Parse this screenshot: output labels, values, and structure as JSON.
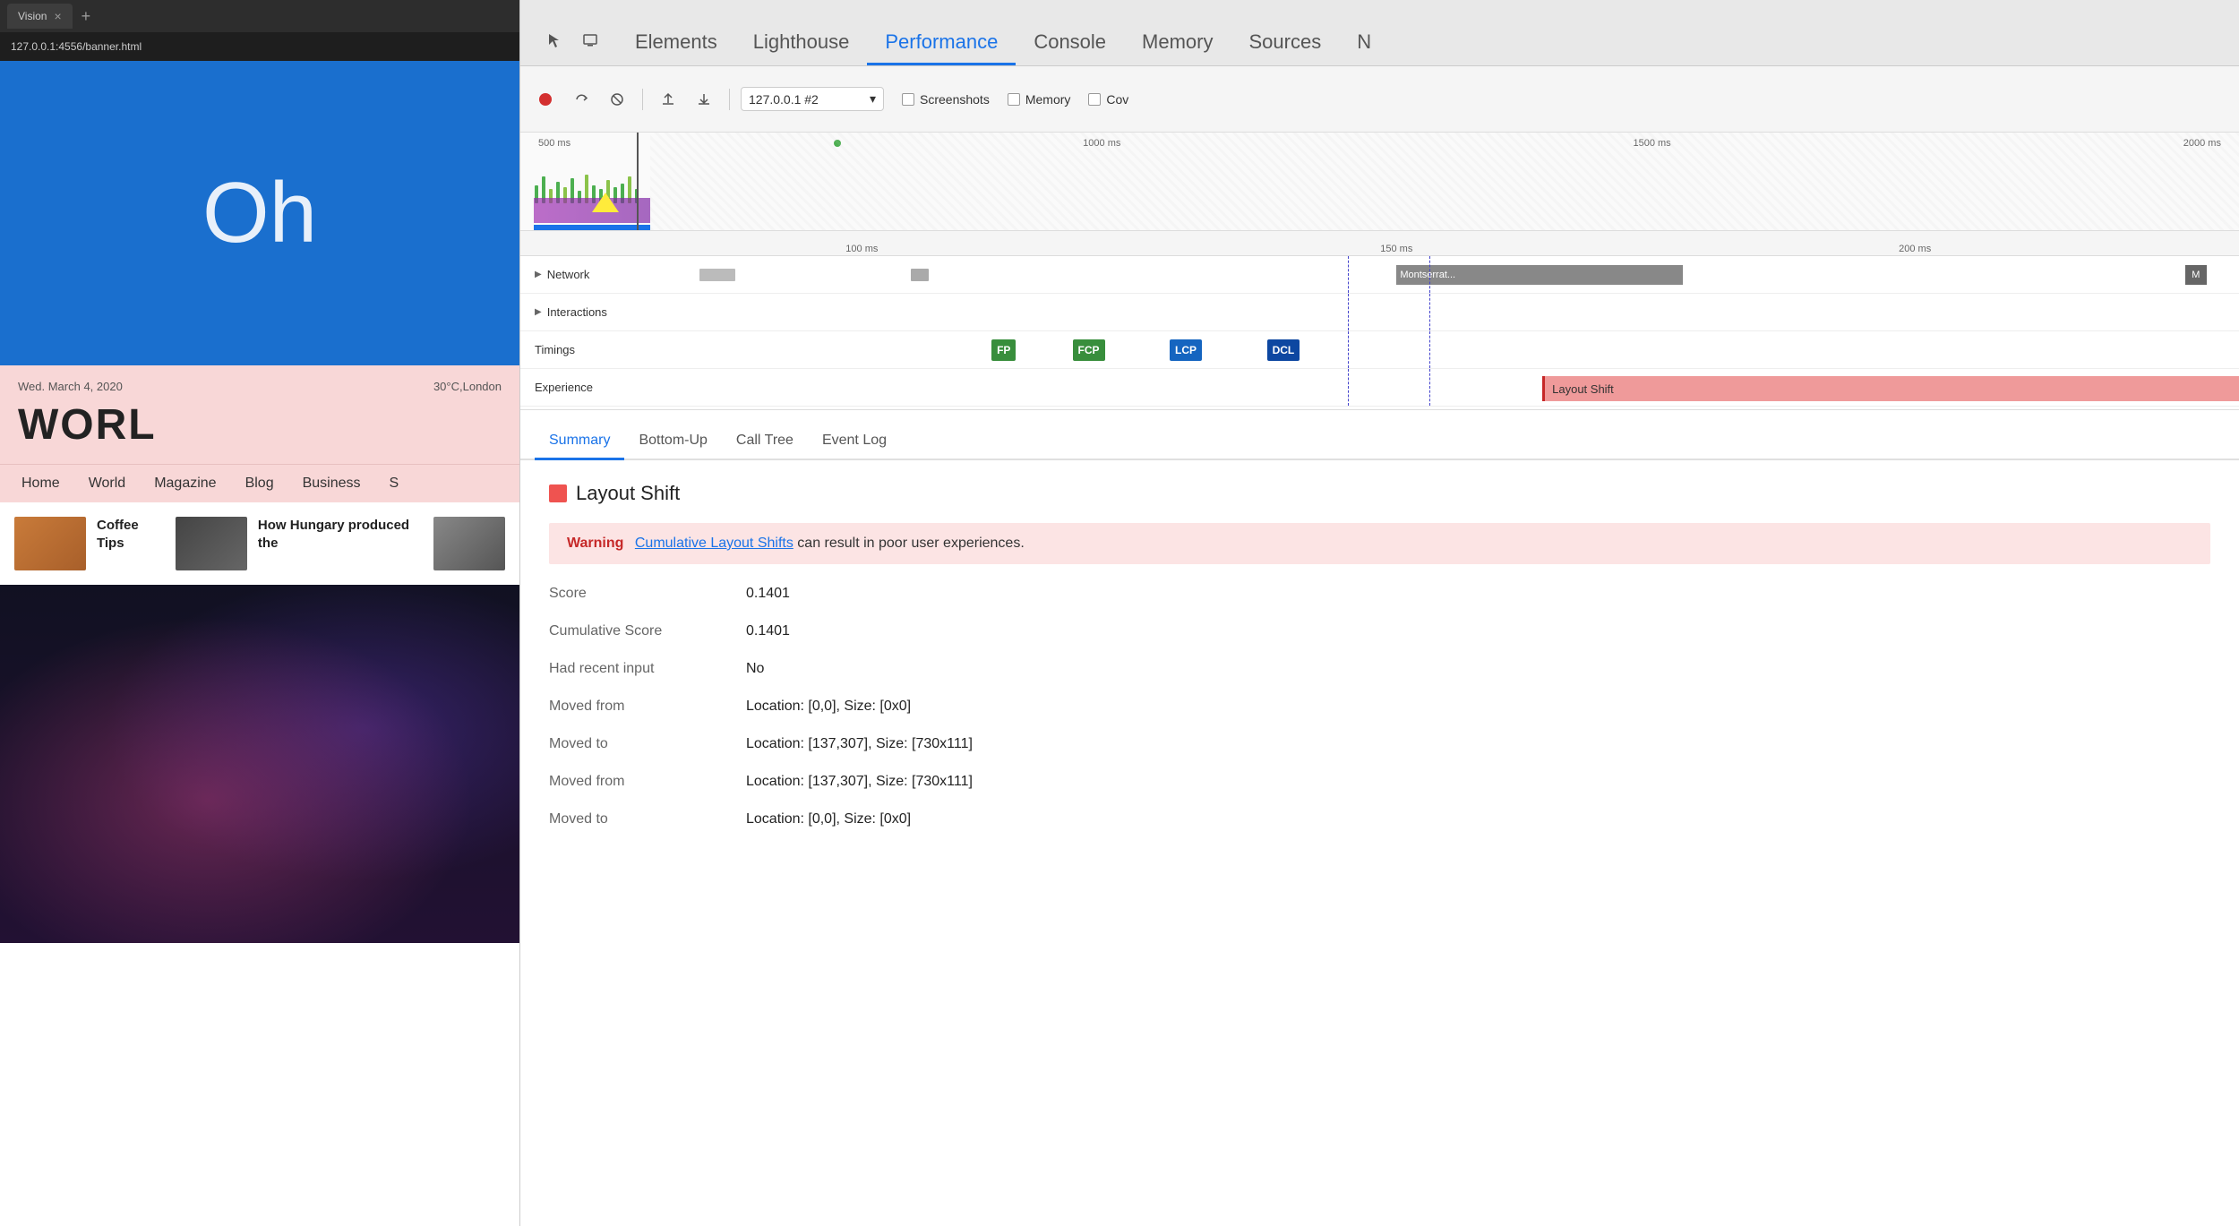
{
  "browser": {
    "tab_title": "Vision",
    "address": "127.0.0.1:4556/banner.html",
    "close_icon": "×",
    "new_tab_icon": "+"
  },
  "webpage": {
    "hero_text": "Oh",
    "date": "Wed. March 4, 2020",
    "location": "30°C,London",
    "headline": "WORL",
    "nav_items": [
      "Home",
      "World",
      "Magazine",
      "Blog",
      "Business",
      "S"
    ],
    "article1_title": "Coffee Tips",
    "article2_title": "How Hungary produced the"
  },
  "devtools": {
    "tabs": [
      {
        "label": "Elements",
        "active": false
      },
      {
        "label": "Lighthouse",
        "active": false
      },
      {
        "label": "Performance",
        "active": true
      },
      {
        "label": "Console",
        "active": false
      },
      {
        "label": "Memory",
        "active": false
      },
      {
        "label": "Sources",
        "active": false
      },
      {
        "label": "N",
        "active": false
      }
    ],
    "toolbar": {
      "profile_label": "127.0.0.1 #2",
      "screenshots_label": "Screenshots",
      "memory_label": "Memory",
      "coverage_label": "Cov"
    },
    "timeline": {
      "time_labels_overview": [
        "500 ms",
        "1000 ms",
        "1500 ms",
        "2000 ms"
      ],
      "time_labels_detail": [
        "100 ms",
        "150 ms",
        "200 ms"
      ],
      "rows": [
        {
          "label": "Network",
          "chevron": true
        },
        {
          "label": "Interactions",
          "chevron": true
        },
        {
          "label": "Timings",
          "chevron": false
        },
        {
          "label": "Experience",
          "chevron": false
        }
      ],
      "network_bar_text": "Montserrat...",
      "network_bar_m": "M",
      "timings": [
        {
          "label": "FP",
          "color": "#388e3c"
        },
        {
          "label": "FCP",
          "color": "#388e3c"
        },
        {
          "label": "LCP",
          "color": "#1565c0"
        },
        {
          "label": "DCL",
          "color": "#1565c0"
        }
      ],
      "layout_shift_bar": "Layout Shift"
    },
    "analysis": {
      "tabs": [
        "Summary",
        "Bottom-Up",
        "Call Tree",
        "Event Log"
      ],
      "active_tab": "Summary",
      "section_title": "Layout Shift",
      "warning_label": "Warning",
      "warning_link": "Cumulative Layout Shifts",
      "warning_text": " can result in poor user experiences.",
      "fields": [
        {
          "label": "Score",
          "value": "0.1401"
        },
        {
          "label": "Cumulative Score",
          "value": "0.1401"
        },
        {
          "label": "Had recent input",
          "value": "No"
        },
        {
          "label": "Moved from",
          "value": "Location: [0,0], Size: [0x0]"
        },
        {
          "label": "Moved to",
          "value": "Location: [137,307], Size: [730x111]"
        },
        {
          "label": "Moved from",
          "value": "Location: [137,307], Size: [730x111]"
        },
        {
          "label": "Moved to",
          "value": "Location: [0,0], Size: [0x0]"
        }
      ]
    }
  }
}
